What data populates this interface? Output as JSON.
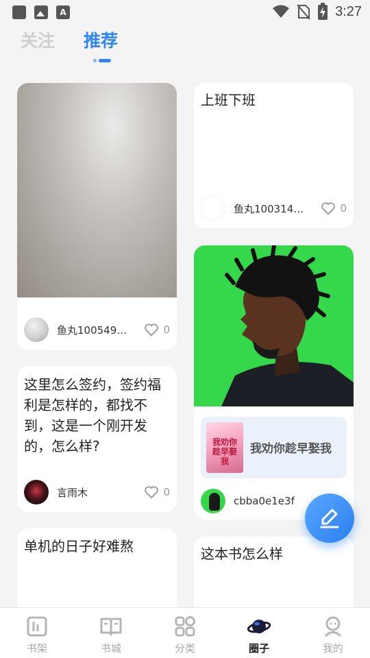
{
  "status_bar": {
    "time": "3:27",
    "notification_icons": [
      "stop-icon",
      "image-icon",
      "font-icon"
    ],
    "system_icons": [
      "wifi-icon",
      "no-sim-icon",
      "battery-charging-icon"
    ]
  },
  "header": {
    "tabs": [
      {
        "label": "关注",
        "active": false
      },
      {
        "label": "推荐",
        "active": true
      }
    ]
  },
  "feed": {
    "left": [
      {
        "type": "photo",
        "author": "鱼丸100549…",
        "likes": "0"
      },
      {
        "type": "text",
        "title": "这里怎么签约，签约福利是怎样的，都找不到，这是一个刚开发的，怎么样?",
        "author": "言雨木",
        "likes": "0"
      },
      {
        "type": "text",
        "title": "单机的日子好难熬"
      }
    ],
    "right": [
      {
        "type": "text",
        "title": "上班下班",
        "author": "鱼丸100314…",
        "likes": "0"
      },
      {
        "type": "photo",
        "book": {
          "title": "我劝你趁早娶我",
          "cover_text": "我劝你趁早娶我"
        },
        "author": "cbba0e1e3f"
      },
      {
        "type": "text",
        "title": "这本书怎么样"
      }
    ]
  },
  "fab": {
    "icon": "pencil-icon"
  },
  "bottom_nav": {
    "items": [
      {
        "label": "书架",
        "icon": "bookshelf-icon",
        "active": false
      },
      {
        "label": "书城",
        "icon": "open-book-icon",
        "active": false
      },
      {
        "label": "分类",
        "icon": "grid-icon",
        "active": false
      },
      {
        "label": "圈子",
        "icon": "planet-icon",
        "active": true
      },
      {
        "label": "我的",
        "icon": "profile-icon",
        "active": false
      }
    ]
  },
  "colors": {
    "accent": "#2f86f6",
    "background": "#f4f4f4",
    "inactive_tab": "#cfcfcf",
    "nav_inactive": "#aaaaaa"
  }
}
